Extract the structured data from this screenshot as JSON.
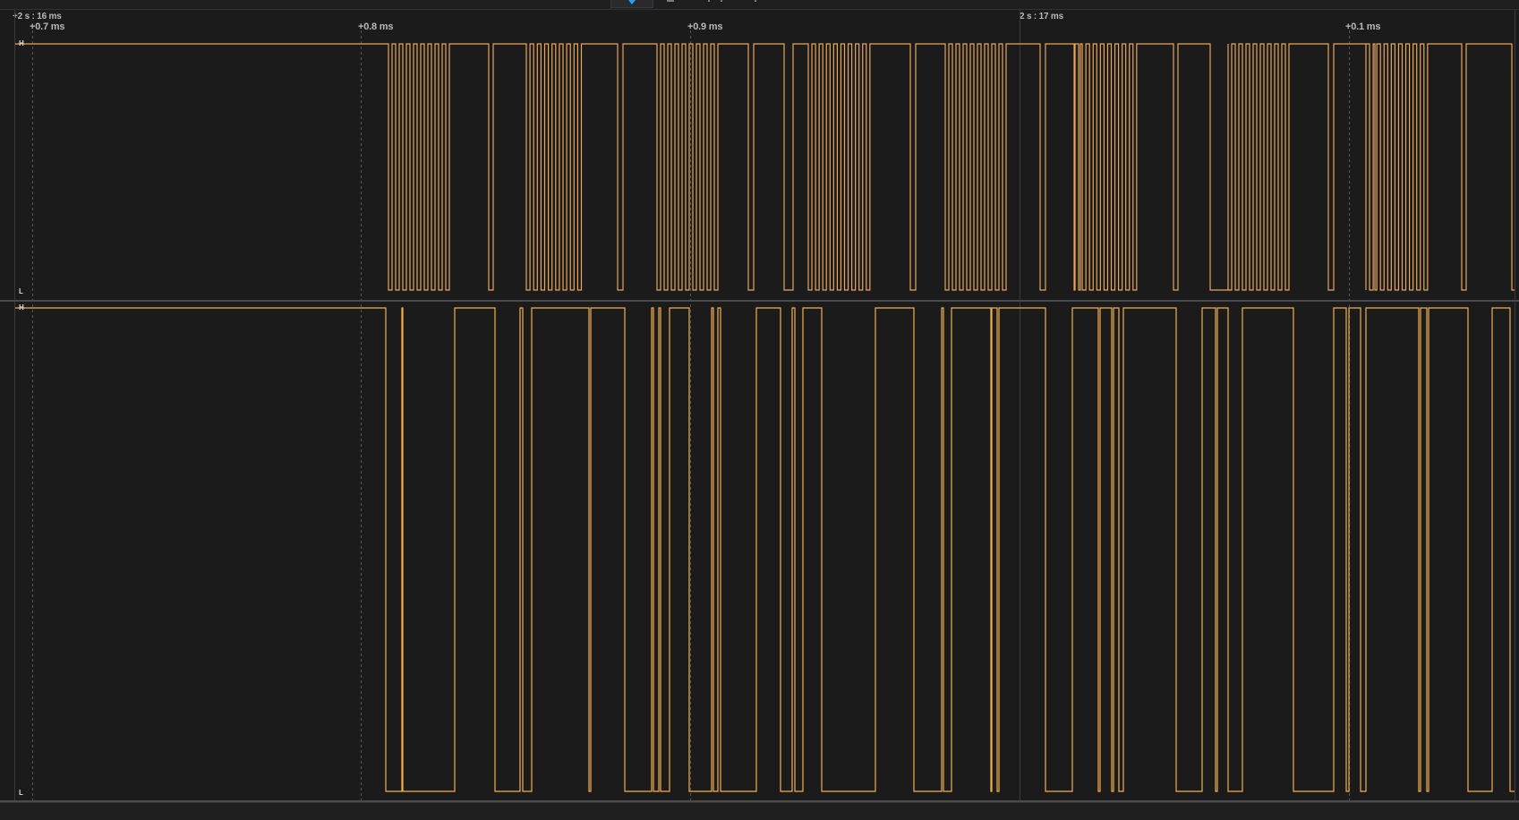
{
  "toolbar": {
    "play_icon": "play-icon",
    "accent_color": "#2b9cf2"
  },
  "timeline": {
    "absolute_labels": [
      "+2 s : 16 ms",
      "2 s : 17 ms"
    ],
    "relative_labels": [
      "+0.7 ms",
      "+0.8 ms",
      "+0.9 ms",
      "+0.1 ms"
    ]
  },
  "channels": [
    {
      "high_label": "H",
      "low_label": "L",
      "color": "#e8a65e"
    },
    {
      "high_label": "H",
      "low_label": "L",
      "color": "#f3b04f"
    }
  ]
}
